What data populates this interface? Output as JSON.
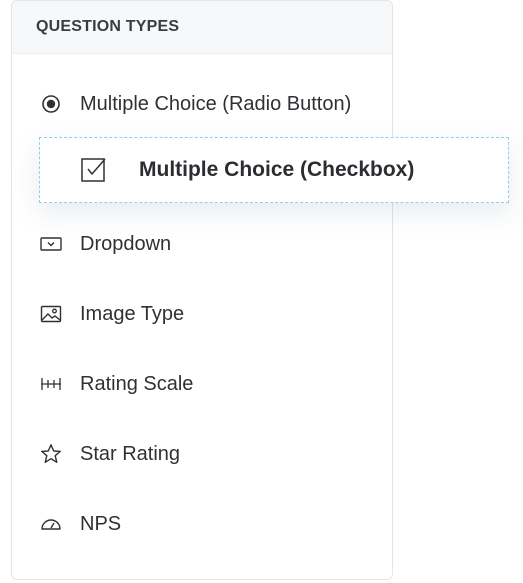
{
  "panel": {
    "title": "QUESTION TYPES"
  },
  "items": [
    {
      "label": "Multiple Choice (Radio Button)",
      "icon": "radio-button-icon"
    },
    {
      "label": "Dropdown",
      "icon": "dropdown-icon"
    },
    {
      "label": "Image Type",
      "icon": "image-icon"
    },
    {
      "label": "Rating Scale",
      "icon": "rating-scale-icon"
    },
    {
      "label": "Star Rating",
      "icon": "star-icon"
    },
    {
      "label": "NPS",
      "icon": "gauge-icon"
    }
  ],
  "dragged_item": {
    "label": "Multiple Choice (Checkbox)",
    "icon": "checkbox-icon"
  },
  "colors": {
    "drag_border": "#8fd0e6",
    "text": "#2f3135",
    "header_bg": "#f7f8f9"
  }
}
